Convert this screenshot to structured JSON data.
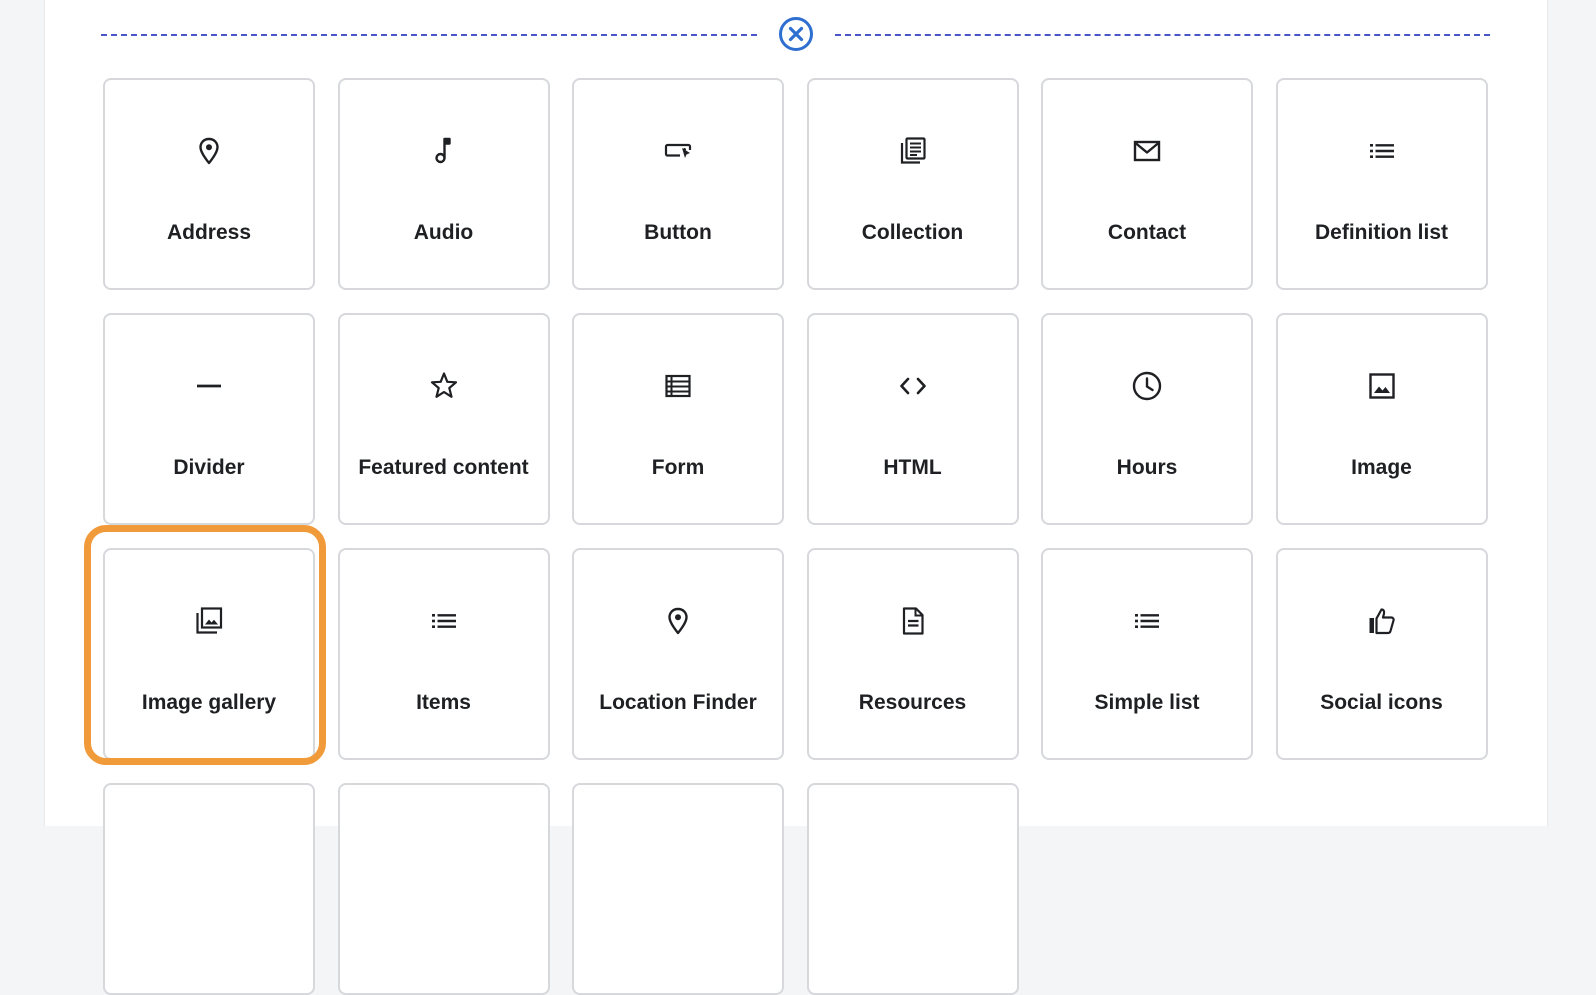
{
  "divider": {
    "close_icon": "close-circle-icon",
    "accent_color": "#4a56c8"
  },
  "highlight_color": "#f09a3a",
  "components": [
    {
      "label": "Address",
      "icon": "location-pin-icon"
    },
    {
      "label": "Audio",
      "icon": "music-note-icon"
    },
    {
      "label": "Button",
      "icon": "button-cursor-icon"
    },
    {
      "label": "Collection",
      "icon": "collection-icon"
    },
    {
      "label": "Contact",
      "icon": "envelope-icon"
    },
    {
      "label": "Definition list",
      "icon": "list-icon"
    },
    {
      "label": "Divider",
      "icon": "horizontal-rule-icon"
    },
    {
      "label": "Featured content",
      "icon": "star-icon"
    },
    {
      "label": "Form",
      "icon": "form-icon"
    },
    {
      "label": "HTML",
      "icon": "code-brackets-icon"
    },
    {
      "label": "Hours",
      "icon": "clock-icon"
    },
    {
      "label": "Image",
      "icon": "image-icon"
    },
    {
      "label": "Image gallery",
      "icon": "image-gallery-icon",
      "selected": true
    },
    {
      "label": "Items",
      "icon": "list-icon"
    },
    {
      "label": "Location Finder",
      "icon": "location-pin-icon"
    },
    {
      "label": "Resources",
      "icon": "document-icon"
    },
    {
      "label": "Simple list",
      "icon": "list-icon"
    },
    {
      "label": "Social icons",
      "icon": "thumbs-up-icon"
    }
  ]
}
